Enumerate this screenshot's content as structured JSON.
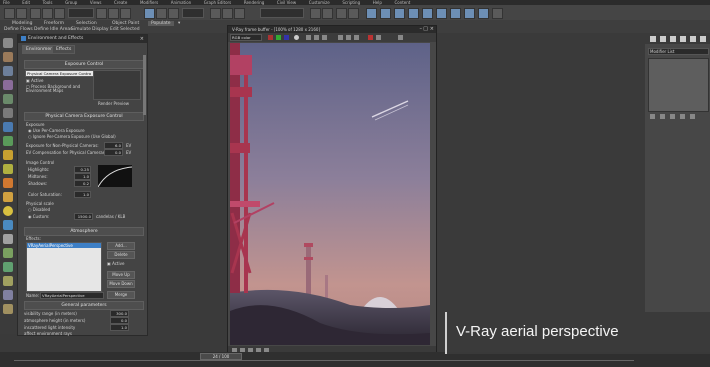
{
  "menubar": [
    "File",
    "Edit",
    "Tools",
    "Group",
    "Views",
    "Create",
    "Modifiers",
    "Animation",
    "Graph Editors",
    "Rendering",
    "Civil View",
    "Customize",
    "Scripting",
    "Help",
    "Content"
  ],
  "ribbon": {
    "tabs": [
      "Modeling",
      "Freeform",
      "Selection",
      "Object Paint",
      "Populate"
    ],
    "active_tab": "Populate",
    "subitems": [
      "Define Flows",
      "Define Idle Areas",
      "Simulate",
      "Display",
      "Edit Selected"
    ]
  },
  "env_dialog": {
    "title": "Environment and Effects",
    "tabs": [
      "Environment",
      "Effects"
    ],
    "exposure_control": {
      "header": "Exposure Control",
      "dropdown": "Physical Camera Exposure Contro",
      "active_label": "Active",
      "process_bg_label": "Process Background and Environment Maps",
      "render_preview": "Render Preview"
    },
    "physical_camera": {
      "header": "Physical Camera Exposure Control",
      "exposure_label": "Exposure",
      "use_per_camera": "Use Per-Camera Exposure",
      "ignore_per_camera": "Ignore Per-Camera Exposure (Use Global)",
      "exposure_nonphysical": "Exposure for Non-Physical Cameras:",
      "exposure_nonphysical_value": "6.0",
      "ev_label": "EV",
      "ev_compensation": "EV Compensation for Physical Cameras:",
      "ev_compensation_value": "0.0",
      "image_control": "Image Control",
      "highlights": "Highlights:",
      "highlights_value": "0.25",
      "midtones": "Midtones:",
      "midtones_value": "1.0",
      "shadows": "Shadows:",
      "shadows_value": "0.2",
      "color_saturation": "Color Saturation:",
      "color_saturation_value": "1.0",
      "physical_scale": "Physical scale",
      "disabled": "Disabled",
      "custom": "Custom:",
      "custom_value": "1500.0",
      "custom_unit": "candelas / KLB"
    },
    "atmosphere": {
      "header": "Atmosphere",
      "effects_label": "Effects:",
      "effect_item": "VRayAerialPerspective",
      "add": "Add...",
      "delete": "Delete",
      "active": "Active",
      "move_up": "Move Up",
      "move_down": "Move Down",
      "name_label": "Name:",
      "name_value": "VRayAerialPerspective",
      "merge": "Merge"
    },
    "general_parameters": {
      "header": "General parameters",
      "visibility_range": "visibility range (in meters)",
      "visibility_range_value": "300.0",
      "atmosphere_height": "atmosphere height (in meters)",
      "atmosphere_height_value": "0.0",
      "inscattered_light": "inscattered light intensity",
      "inscattered_light_value": "1.0",
      "affect_env_rays": "affect environment rays"
    }
  },
  "vfb": {
    "title": "V-Ray frame buffer - [100% of 1280 x 2160]",
    "channel": "RGB color"
  },
  "right_panel": {
    "modifier_list": "Modifier List"
  },
  "timeline": {
    "frame": "24 / 100"
  },
  "caption": {
    "text": "V-Ray aerial perspective"
  },
  "colors": {
    "accent_blue": "#3d7fc6",
    "sky_top": "#6b6f8e",
    "sky_bottom": "#c89a8e",
    "structure": "#a8354f"
  }
}
